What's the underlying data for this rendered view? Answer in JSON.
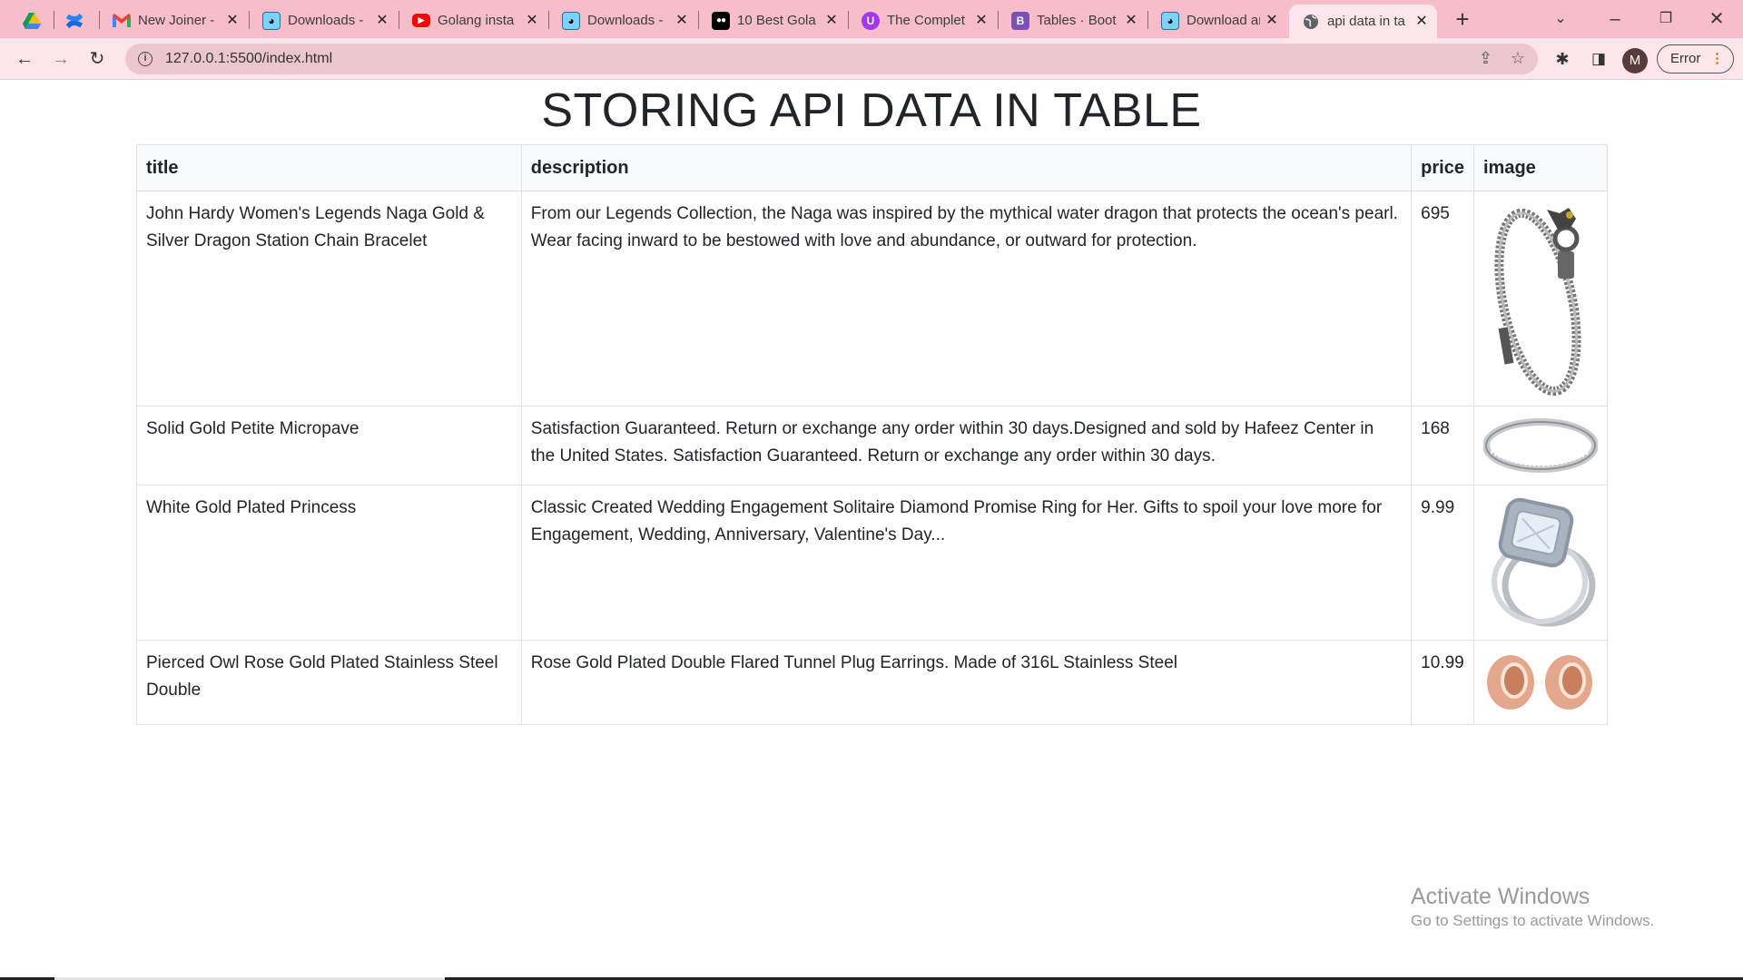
{
  "browser": {
    "tabs": [
      {
        "title": "",
        "icon": "google-drive-icon",
        "color": "#fbbc04"
      },
      {
        "title": "",
        "icon": "confluence-icon",
        "color": "#1868db"
      },
      {
        "title": "New Joiner -",
        "icon": "gmail-icon",
        "color": "#ea4335"
      },
      {
        "title": "Downloads -",
        "icon": "gopher-icon",
        "color": "#79d4fd"
      },
      {
        "title": "Golang insta",
        "icon": "youtube-icon",
        "color": "#ff0000"
      },
      {
        "title": "Downloads -",
        "icon": "gopher-icon",
        "color": "#79d4fd"
      },
      {
        "title": "10 Best Gola",
        "icon": "medium-icon",
        "color": "#000000"
      },
      {
        "title": "The Complet",
        "icon": "udemy-icon",
        "color": "#a435f0"
      },
      {
        "title": "Tables · Boot",
        "icon": "bootstrap-icon",
        "color": "#7952b3"
      },
      {
        "title": "Download ar",
        "icon": "gopher-icon",
        "color": "#79d4fd"
      },
      {
        "title": "api data in ta",
        "icon": "globe-icon",
        "color": "#5f6368"
      }
    ],
    "new_tab_label": "+",
    "url": "127.0.0.1:5500/index.html",
    "profile_initial": "M",
    "error_label": "Error"
  },
  "page": {
    "title": "STORING API DATA IN TABLE",
    "columns": [
      "title",
      "description",
      "price",
      "image"
    ],
    "rows": [
      {
        "title": "John Hardy Women's Legends Naga Gold & Silver Dragon Station Chain Bracelet",
        "description": "From our Legends Collection, the Naga was inspired by the mythical water dragon that protects the ocean's pearl. Wear facing inward to be bestowed with love and abundance, or outward for protection.",
        "price": "695",
        "image": "bracelet-image"
      },
      {
        "title": "Solid Gold Petite Micropave",
        "description": "Satisfaction Guaranteed. Return or exchange any order within 30 days.Designed and sold by Hafeez Center in the United States. Satisfaction Guaranteed. Return or exchange any order within 30 days.",
        "price": "168",
        "image": "ring-image"
      },
      {
        "title": "White Gold Plated Princess",
        "description": "Classic Created Wedding Engagement Solitaire Diamond Promise Ring for Her. Gifts to spoil your love more for Engagement, Wedding, Anniversary, Valentine's Day...",
        "price": "9.99",
        "image": "engagement-ring-image"
      },
      {
        "title": "Pierced Owl Rose Gold Plated Stainless Steel Double",
        "description": "Rose Gold Plated Double Flared Tunnel Plug Earrings. Made of 316L Stainless Steel",
        "price": "10.99",
        "image": "plug-earrings-image"
      }
    ]
  },
  "watermark": {
    "line1": "Activate Windows",
    "line2": "Go to Settings to activate Windows."
  }
}
